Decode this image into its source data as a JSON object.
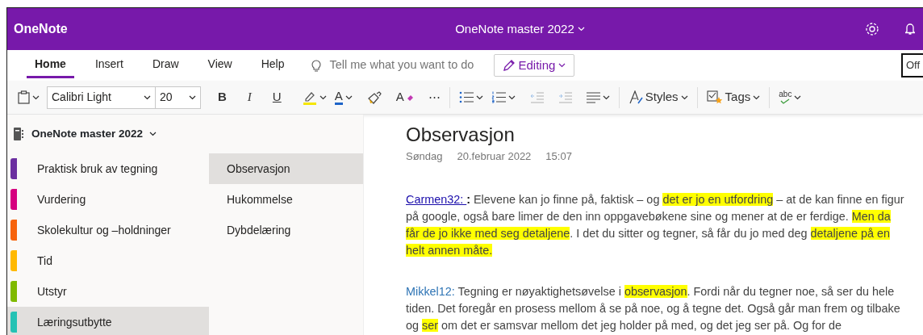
{
  "app": {
    "name": "OneNote",
    "notebook_title": "OneNote master 2022",
    "clipped_button": "Off"
  },
  "ribbon_tabs": [
    {
      "label": "Home",
      "selected": true
    },
    {
      "label": "Insert",
      "selected": false
    },
    {
      "label": "Draw",
      "selected": false
    },
    {
      "label": "View",
      "selected": false
    },
    {
      "label": "Help",
      "selected": false
    }
  ],
  "tell_me": {
    "placeholder": "Tell me what you want to do"
  },
  "mode_button": "Editing",
  "toolbar": {
    "font_family": "Calibri Light",
    "font_size": "20",
    "bold": "B",
    "italic": "I",
    "underline": "U",
    "font_color": "A",
    "clear_formatting": "A",
    "more": "⋯",
    "indent_disabled": true,
    "styles": "Styles",
    "tags": "Tags",
    "spelling": "abc"
  },
  "notebook": {
    "title": "OneNote master 2022"
  },
  "sections": [
    {
      "label": "Praktisk bruk av tegning",
      "color": "#6b2fa0",
      "selected": false
    },
    {
      "label": "Vurdering",
      "color": "#d6007f",
      "selected": false
    },
    {
      "label": "Skolekultur og –holdninger",
      "color": "#f7630c",
      "selected": false
    },
    {
      "label": "Tid",
      "color": "#ffb900",
      "selected": false
    },
    {
      "label": "Utstyr",
      "color": "#7fba00",
      "selected": false
    },
    {
      "label": "Læringsutbytte",
      "color": "#25c2b4",
      "selected": true
    }
  ],
  "pages": [
    {
      "label": "Observasjon",
      "selected": true
    },
    {
      "label": "Hukommelse",
      "selected": false
    },
    {
      "label": "Dybdelæring",
      "selected": false
    }
  ],
  "page": {
    "title": "Observasjon",
    "day": "Søndag",
    "date": "20.februar 2022",
    "time": "15:07",
    "paragraphs": [
      {
        "speaker": "Carmen32: ",
        "speaker_underlined": true,
        "segments": [
          {
            "text": ":",
            "bold": true,
            "highlight": false
          },
          {
            "text": " Elevene kan jo finne på, faktisk – og ",
            "bold": false,
            "highlight": false
          },
          {
            "text": "det er jo en utfordring",
            "bold": false,
            "highlight": true
          },
          {
            "text": " – at de kan finne en figur på google, også bare limer de den inn oppgavebøkene sine og mener at de er ferdige. ",
            "bold": false,
            "highlight": false
          },
          {
            "text": "Men da får de jo ikke med seg detaljene",
            "bold": false,
            "highlight": true
          },
          {
            "text": ". I det du sitter og tegner, så får du jo med deg ",
            "bold": false,
            "highlight": false
          },
          {
            "text": "detaljene på en helt annen måte.",
            "bold": false,
            "highlight": true
          }
        ]
      },
      {
        "speaker": "Mikkel12:",
        "speaker_underlined": false,
        "segments": [
          {
            "text": " Tegning er nøyaktighetsøvelse i ",
            "bold": false,
            "highlight": false
          },
          {
            "text": "observasjon",
            "bold": false,
            "highlight": true
          },
          {
            "text": ". Fordi når du tegner noe, så ser du hele tiden. Det foregår en prosess mellom å se på noe, og å tegne det. Også går man frem og tilbake og ",
            "bold": false,
            "highlight": false
          },
          {
            "text": "ser",
            "bold": false,
            "highlight": true
          },
          {
            "text": " om det er samsvar mellom det jeg holder på med, og det jeg ser på. Og for de",
            "bold": false,
            "highlight": false
          }
        ]
      }
    ]
  }
}
